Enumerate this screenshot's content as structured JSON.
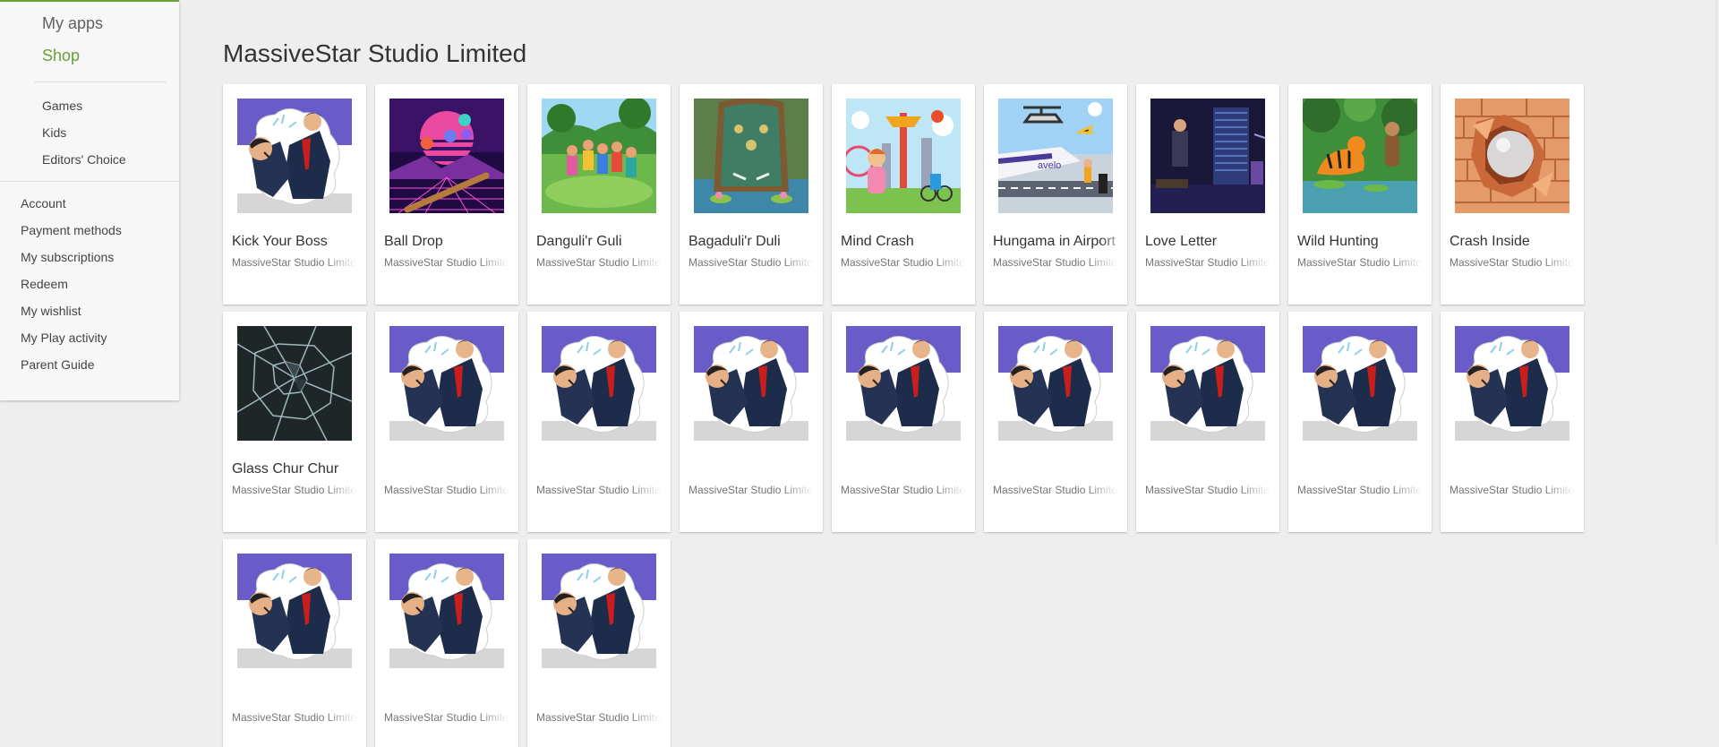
{
  "sidebar": {
    "top": [
      {
        "label": "My apps"
      },
      {
        "label": "Shop"
      }
    ],
    "categories": [
      {
        "label": "Games"
      },
      {
        "label": "Kids"
      },
      {
        "label": "Editors' Choice"
      }
    ],
    "account": [
      {
        "label": "Account"
      },
      {
        "label": "Payment methods"
      },
      {
        "label": "My subscriptions"
      },
      {
        "label": "Redeem"
      },
      {
        "label": "My wishlist"
      },
      {
        "label": "My Play activity"
      },
      {
        "label": "Parent Guide"
      }
    ]
  },
  "main": {
    "title": "MassiveStar Studio Limited",
    "apps": [
      {
        "title": "Kick Your Boss",
        "developer": "MassiveStar Studio Limited",
        "icon": "boss-cartoon-icon"
      },
      {
        "title": "Ball Drop",
        "developer": "MassiveStar Studio Limited",
        "icon": "retrowave-balls-icon"
      },
      {
        "title": "Danguli'r Guli",
        "developer": "MassiveStar Studio Limited",
        "icon": "kids-playing-icon"
      },
      {
        "title": "Bagaduli'r Duli",
        "developer": "MassiveStar Studio Limited",
        "icon": "pinball-board-icon"
      },
      {
        "title": "Mind Crash",
        "developer": "MassiveStar Studio Limited",
        "icon": "amusement-park-icon"
      },
      {
        "title": "Hungama in Airport",
        "developer": "MassiveStar Studio Limited",
        "icon": "airport-icon"
      },
      {
        "title": "Love Letter",
        "developer": "MassiveStar Studio Limited",
        "icon": "dark-room-icon"
      },
      {
        "title": "Wild Hunting",
        "developer": "MassiveStar Studio Limited",
        "icon": "jungle-tiger-icon"
      },
      {
        "title": "Crash Inside",
        "developer": "MassiveStar Studio Limited",
        "icon": "brick-wall-ball-icon"
      },
      {
        "title": "Glass Chur Chur",
        "developer": "MassiveStar Studio Limited",
        "icon": "broken-glass-icon"
      },
      {
        "title": "",
        "developer": "MassiveStar Studio Limited",
        "icon": "boss-cartoon-icon"
      },
      {
        "title": "",
        "developer": "MassiveStar Studio Limited",
        "icon": "boss-cartoon-icon"
      },
      {
        "title": "",
        "developer": "MassiveStar Studio Limited",
        "icon": "boss-cartoon-icon"
      },
      {
        "title": "",
        "developer": "MassiveStar Studio Limited",
        "icon": "boss-cartoon-icon"
      },
      {
        "title": "",
        "developer": "MassiveStar Studio Limited",
        "icon": "boss-cartoon-icon"
      },
      {
        "title": "",
        "developer": "MassiveStar Studio Limited",
        "icon": "boss-cartoon-icon"
      },
      {
        "title": "",
        "developer": "MassiveStar Studio Limited",
        "icon": "boss-cartoon-icon"
      },
      {
        "title": "",
        "developer": "MassiveStar Studio Limited",
        "icon": "boss-cartoon-icon"
      },
      {
        "title": "",
        "developer": "MassiveStar Studio Limited",
        "icon": "boss-cartoon-icon"
      },
      {
        "title": "",
        "developer": "MassiveStar Studio Limited",
        "icon": "boss-cartoon-icon"
      },
      {
        "title": "",
        "developer": "MassiveStar Studio Limited",
        "icon": "boss-cartoon-icon"
      }
    ]
  },
  "colors": {
    "accent": "#689f38",
    "background": "#eeeeee",
    "card": "#ffffff"
  }
}
